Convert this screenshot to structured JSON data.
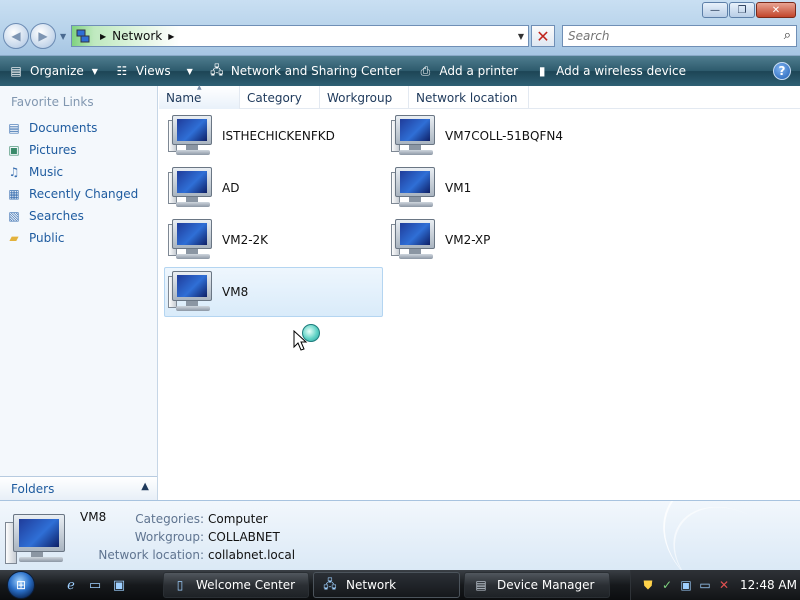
{
  "window": {
    "minimize_glyph": "—",
    "maximize_glyph": "❐",
    "close_glyph": "✕"
  },
  "address": {
    "crumb": "Network",
    "back_glyph": "◀",
    "forward_glyph": "▶",
    "stop_glyph": "✕"
  },
  "search": {
    "placeholder": "Search"
  },
  "commands": {
    "organize": "Organize",
    "views": "Views",
    "network_sharing": "Network and Sharing Center",
    "add_printer": "Add a printer",
    "add_wireless": "Add a wireless device",
    "help_glyph": "?"
  },
  "nav": {
    "heading": "Favorite Links",
    "items": [
      {
        "label": "Documents",
        "icon": "documents-icon"
      },
      {
        "label": "Pictures",
        "icon": "pictures-icon"
      },
      {
        "label": "Music",
        "icon": "music-icon"
      },
      {
        "label": "Recently Changed",
        "icon": "recently-changed-icon"
      },
      {
        "label": "Searches",
        "icon": "searches-icon"
      },
      {
        "label": "Public",
        "icon": "public-folder-icon"
      }
    ],
    "folders_label": "Folders"
  },
  "columns": [
    "Name",
    "Category",
    "Workgroup",
    "Network location"
  ],
  "computers": [
    {
      "name": "ISTHECHICKENFKD"
    },
    {
      "name": "VM7COLL-51BQFN4"
    },
    {
      "name": "AD"
    },
    {
      "name": "VM1"
    },
    {
      "name": "VM2-2K"
    },
    {
      "name": "VM2-XP"
    },
    {
      "name": "VM8",
      "selected": true
    }
  ],
  "details": {
    "name": "VM8",
    "categories_label": "Categories:",
    "categories_value": "Computer",
    "workgroup_label": "Workgroup:",
    "workgroup_value": "COLLABNET",
    "location_label": "Network location:",
    "location_value": "collabnet.local"
  },
  "taskbar": {
    "start_glyph": "⊞",
    "buttons": [
      {
        "label": "Welcome Center",
        "icon": "welcome-center-icon"
      },
      {
        "label": "Network",
        "icon": "network-icon",
        "active": true
      },
      {
        "label": "Device Manager",
        "icon": "device-manager-icon"
      }
    ],
    "clock": "12:48 AM"
  },
  "colors": {
    "command_bar": "#2d5a6c",
    "link_blue": "#1e5b9f",
    "selection_bg": "#d9ebfa"
  }
}
